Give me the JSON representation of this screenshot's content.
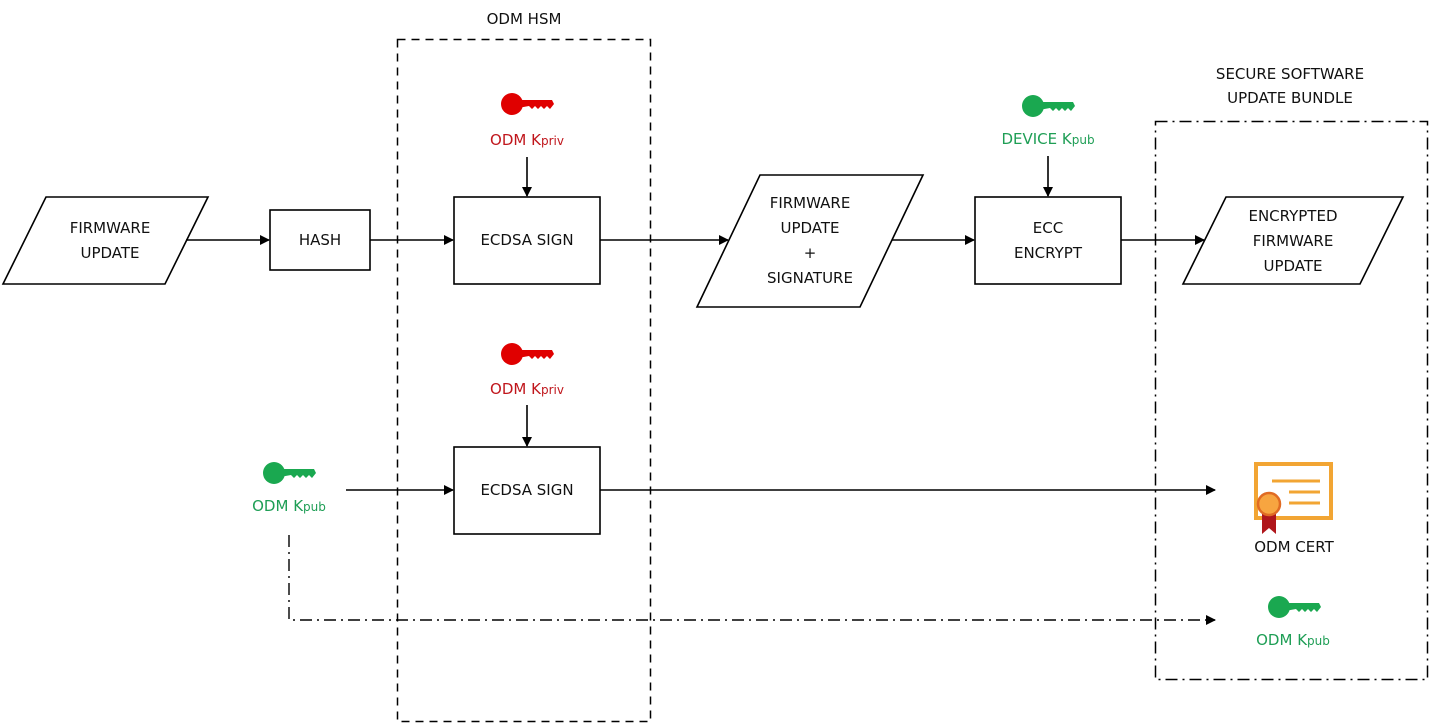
{
  "groups": {
    "hsm": {
      "title": "ODM HSM"
    },
    "bundle": {
      "title_line1": "SECURE SOFTWARE",
      "title_line2": "UPDATE BUNDLE"
    }
  },
  "nodes": {
    "firmware_update": {
      "line1": "FIRMWARE",
      "line2": "UPDATE"
    },
    "hash": {
      "label": "HASH"
    },
    "ecdsa_sign_1": {
      "label": "ECDSA SIGN"
    },
    "ecdsa_sign_2": {
      "label": "ECDSA SIGN"
    },
    "fw_sig": {
      "line1": "FIRMWARE",
      "line2": "UPDATE",
      "line3": "+",
      "line4": "SIGNATURE"
    },
    "ecc_encrypt": {
      "line1": "ECC",
      "line2": "ENCRYPT"
    },
    "encrypted_fw": {
      "line1": "ENCRYPTED",
      "line2": "FIRMWARE",
      "line3": "UPDATE"
    },
    "odm_cert": {
      "label": "ODM CERT"
    }
  },
  "keys": {
    "odm_priv_1": {
      "main": "ODM K",
      "sub": "priv",
      "color": "#e00000"
    },
    "odm_priv_2": {
      "main": "ODM K",
      "sub": "priv",
      "color": "#e00000"
    },
    "device_pub": {
      "main": "DEVICE K",
      "sub": "pub",
      "color": "#1aa850"
    },
    "odm_pub_src": {
      "main": "ODM K",
      "sub": "pub",
      "color": "#1aa850"
    },
    "odm_pub_bundle": {
      "main": "ODM K",
      "sub": "pub",
      "color": "#1aa850"
    }
  },
  "colors": {
    "cert_frame": "#f2a533",
    "cert_seal": "#f7a540",
    "cert_ribbon": "#b0161c"
  }
}
